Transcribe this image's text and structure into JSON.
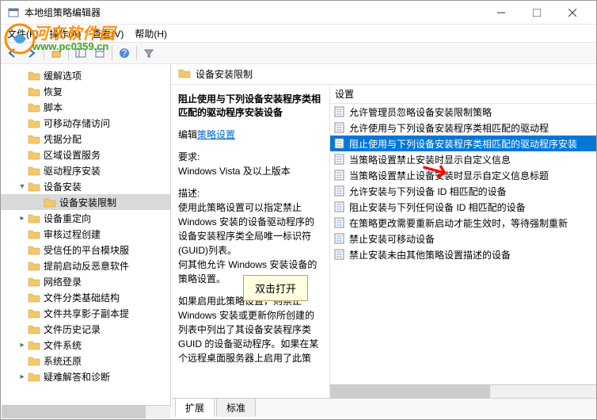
{
  "window": {
    "title": "本地组策略编辑器"
  },
  "menu": {
    "file": "文件(F)",
    "action": "操作(A)",
    "view": "查看(V)",
    "help": "帮助(H)"
  },
  "tree": {
    "items": [
      {
        "label": "缓解选项",
        "exp": ""
      },
      {
        "label": "恢复",
        "exp": ""
      },
      {
        "label": "脚本",
        "exp": ""
      },
      {
        "label": "可移动存储访问",
        "exp": ""
      },
      {
        "label": "凭据分配",
        "exp": ""
      },
      {
        "label": "区域设置服务",
        "exp": ""
      },
      {
        "label": "驱动程序安装",
        "exp": ""
      },
      {
        "label": "设备安装",
        "exp": "▾",
        "expanded": true
      },
      {
        "label": "设备安装限制",
        "exp": "",
        "level": 2,
        "selected": true
      },
      {
        "label": "设备重定向",
        "exp": "▸"
      },
      {
        "label": "审核过程创建",
        "exp": ""
      },
      {
        "label": "受信任的平台模块服",
        "exp": ""
      },
      {
        "label": "提前启动反恶意软件",
        "exp": ""
      },
      {
        "label": "网络登录",
        "exp": ""
      },
      {
        "label": "文件分类基础结构",
        "exp": ""
      },
      {
        "label": "文件共享影子副本提",
        "exp": ""
      },
      {
        "label": "文件历史记录",
        "exp": ""
      },
      {
        "label": "文件系统",
        "exp": "▸"
      },
      {
        "label": "系统还原",
        "exp": ""
      },
      {
        "label": "疑难解答和诊断",
        "exp": "▸"
      }
    ]
  },
  "content": {
    "heading": "设备安装限制",
    "detail_title": "阻止使用与下列设备安装程序类相匹配的驱动程序安装设备",
    "edit_label": "编辑",
    "link": "策略设置",
    "req_label": "要求:",
    "req_value": "Windows Vista 及以上版本",
    "desc_label": "描述:",
    "desc_text": "使用此策略设置可以指定禁止 Windows 安装的设备驱动程序的设备安装程序类全局唯一标识符(GUID)列表。",
    "desc_text2": "何其他允许 Windows 安装设备的策略设置。",
    "desc_text3": "如果启用此策略设置，则禁止 Windows 安装或更新你所创建的列表中列出了其设备安装程序类 GUID 的设备驱动程序。如果在某个远程桌面服务器上启用了此策"
  },
  "list": {
    "header": "设置",
    "rows": [
      {
        "label": "允许管理员忽略设备安装限制策略"
      },
      {
        "label": "允许使用与下列设备安装程序类相匹配的驱动程"
      },
      {
        "label": "阻止使用与下列设备安装程序类相匹配的驱动程序安装",
        "selected": true
      },
      {
        "label": "当策略设置禁止安装时显示自定义信息"
      },
      {
        "label": "当策略设置禁止设备安装时显示自定义信息标题"
      },
      {
        "label": "允许安装与下列设备 ID 相匹配的设备"
      },
      {
        "label": "阻止安装与下列任何设备 ID 相匹配的设备"
      },
      {
        "label": "在策略更改需要重新启动才能生效时，等待强制重新"
      },
      {
        "label": "禁止安装可移动设备"
      },
      {
        "label": "禁止安装未由其他策略设置描述的设备"
      }
    ]
  },
  "tabs": {
    "extended": "扩展",
    "standard": "标准"
  },
  "tooltip": "双击打开",
  "watermark": {
    "line1": "河东软件园",
    "line2": "www.pc0359.cn"
  }
}
